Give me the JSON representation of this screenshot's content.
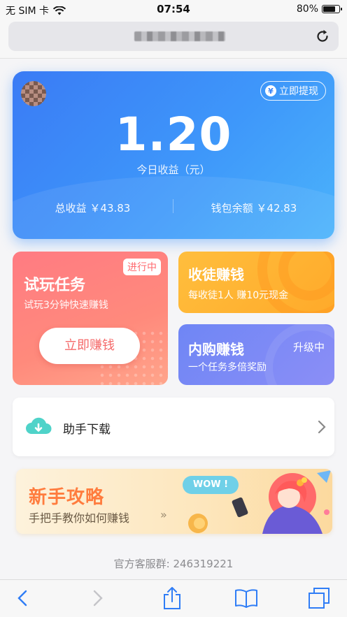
{
  "status_bar": {
    "carrier": "无 SIM 卡",
    "time": "07:54",
    "battery": "80%",
    "battery_level": 0.8
  },
  "browser": {
    "url_blurred": true
  },
  "earnings": {
    "withdraw_label": "立即提现",
    "withdraw_icon": "yen-icon",
    "today_value": "1.20",
    "today_label": "今日收益（元）",
    "total_label": "总收益 ￥43.83",
    "wallet_label": "钱包余额 ￥42.83"
  },
  "cards": {
    "trial": {
      "title": "试玩任务",
      "subtitle": "试玩3分钟快速赚钱",
      "badge": "进行中",
      "button": "立即赚钱"
    },
    "recruit": {
      "title": "收徒赚钱",
      "subtitle": "每收徒1人 赚10元现金"
    },
    "purchase": {
      "title": "内购赚钱",
      "badge": "升级中",
      "subtitle": "一个任务多倍奖励"
    }
  },
  "helper": {
    "label": "助手下载",
    "icon": "cloud-download-icon"
  },
  "guide": {
    "title": "新手攻略",
    "subtitle": "手把手教你如何赚钱",
    "arrows": "»",
    "bubble": "WOW !"
  },
  "footer": {
    "service": "官方客服群:  246319221"
  },
  "toolbar": {
    "icons": [
      "back-icon",
      "forward-icon",
      "share-icon",
      "bookmarks-icon",
      "tabs-icon"
    ]
  },
  "colors": {
    "earn_card": "#3e97fa",
    "trial_card": "#ff7b82",
    "recruit_card": "#ffb333",
    "purchase_card": "#7b8af5",
    "guide_title": "#ff7c3e",
    "toolbar_accent": "#2f7df6"
  }
}
